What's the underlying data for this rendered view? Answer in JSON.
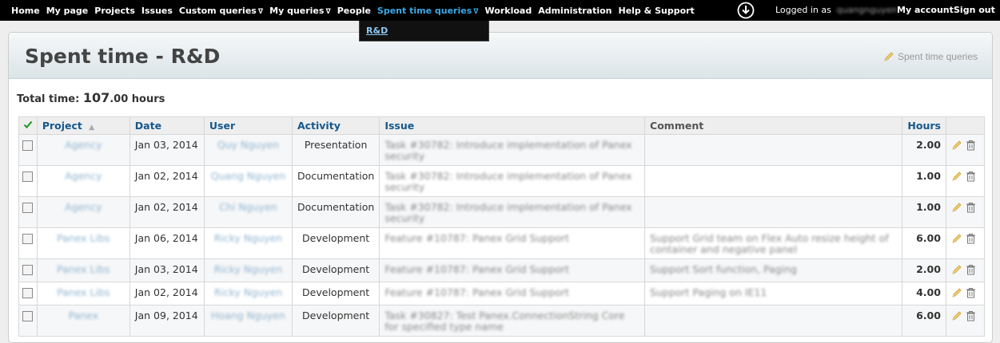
{
  "menu": {
    "items": [
      {
        "label": "Home",
        "active": false,
        "arrow": false
      },
      {
        "label": "My page",
        "active": false,
        "arrow": false
      },
      {
        "label": "Projects",
        "active": false,
        "arrow": false
      },
      {
        "label": "Issues",
        "active": false,
        "arrow": false
      },
      {
        "label": "Custom queries",
        "active": false,
        "arrow": true
      },
      {
        "label": "My queries",
        "active": false,
        "arrow": true
      },
      {
        "label": "People",
        "active": false,
        "arrow": false
      },
      {
        "label": "Spent time queries",
        "active": true,
        "arrow": true
      },
      {
        "label": "Workload",
        "active": false,
        "arrow": false
      },
      {
        "label": "Administration",
        "active": false,
        "arrow": false
      },
      {
        "label": "Help & Support",
        "active": false,
        "arrow": false
      }
    ],
    "arrow_glyph": "∇",
    "logged_in_label": "Logged in as",
    "logged_in_user": "quangnguyen",
    "my_account": "My account",
    "sign_out": "Sign out",
    "download_icon": "download-icon",
    "active_color": "#3ba8e6"
  },
  "dropdown": {
    "items": [
      "R&D"
    ]
  },
  "header": {
    "title": "Spent time - R&D",
    "queries_link": "Spent time queries"
  },
  "total": {
    "label": "Total time:",
    "whole": "107",
    "decimal": ".00",
    "unit": "hours"
  },
  "table": {
    "columns": {
      "project": "Project",
      "date": "Date",
      "user": "User",
      "activity": "Activity",
      "issue": "Issue",
      "comment": "Comment",
      "hours": "Hours"
    },
    "sort_indicator": "▲",
    "rows": [
      {
        "project": "Agency",
        "date": "Jan 03, 2014",
        "user": "Quy Nguyen",
        "activity": "Presentation",
        "issue": "Task #30782: Introduce implementation of Panex security",
        "comment": "",
        "hours": "2.00"
      },
      {
        "project": "Agency",
        "date": "Jan 02, 2014",
        "user": "Quang Nguyen",
        "activity": "Documentation",
        "issue": "Task #30782: Introduce implementation of Panex security",
        "comment": "",
        "hours": "1.00"
      },
      {
        "project": "Agency",
        "date": "Jan 02, 2014",
        "user": "Chi Nguyen",
        "activity": "Documentation",
        "issue": "Task #30782: Introduce implementation of Panex security",
        "comment": "",
        "hours": "1.00"
      },
      {
        "project": "Panex Libs",
        "date": "Jan 06, 2014",
        "user": "Ricky Nguyen",
        "activity": "Development",
        "issue": "Feature #10787: Panex Grid Support",
        "comment": "Support Grid team on Flex Auto resize height of container and negative panel",
        "hours": "6.00"
      },
      {
        "project": "Panex Libs",
        "date": "Jan 03, 2014",
        "user": "Ricky Nguyen",
        "activity": "Development",
        "issue": "Feature #10787: Panex Grid Support",
        "comment": "Support Sort function, Paging",
        "hours": "2.00"
      },
      {
        "project": "Panex Libs",
        "date": "Jan 02, 2014",
        "user": "Ricky Nguyen",
        "activity": "Development",
        "issue": "Feature #10787: Panex Grid Support",
        "comment": "Support Paging on IE11",
        "hours": "4.00"
      },
      {
        "project": "Panex",
        "date": "Jan 09, 2014",
        "user": "Hoang Nguyen",
        "activity": "Development",
        "issue": "Task #30827: Test Panex.ConnectionString Core for specified type name",
        "comment": "",
        "hours": "6.00"
      }
    ]
  }
}
